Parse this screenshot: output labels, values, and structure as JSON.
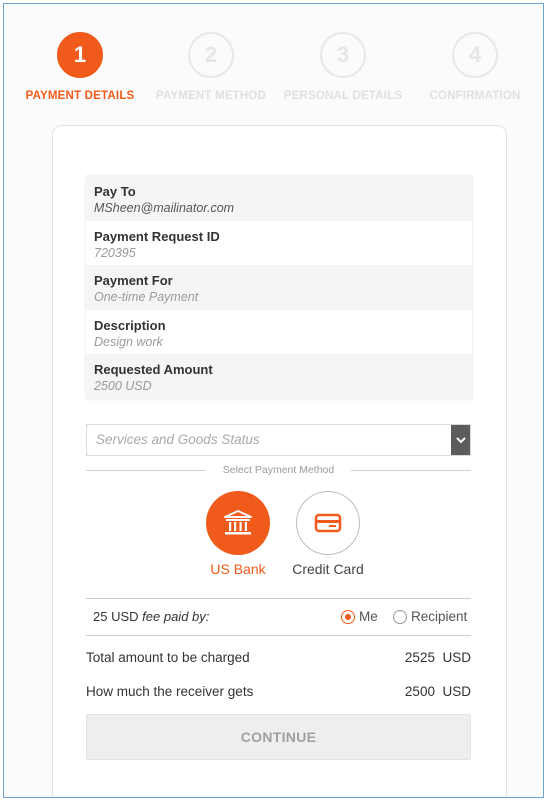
{
  "steps": [
    {
      "number": "1",
      "label": "PAYMENT DETAILS"
    },
    {
      "number": "2",
      "label": "PAYMENT METHOD"
    },
    {
      "number": "3",
      "label": "PERSONAL DETAILS"
    },
    {
      "number": "4",
      "label": "CONFIRMATION"
    }
  ],
  "summary": [
    {
      "label": "Pay To",
      "value": "MSheen@mailinator.com"
    },
    {
      "label": "Payment Request ID",
      "value": "720395"
    },
    {
      "label": "Payment For",
      "value": "One-time Payment"
    },
    {
      "label": "Description",
      "value": "Design work"
    },
    {
      "label": "Requested Amount",
      "value": "2500 USD"
    }
  ],
  "status_select": {
    "placeholder": "Services and Goods Status"
  },
  "method_divider": "Select Payment Method",
  "methods": [
    {
      "label": "US Bank",
      "icon": "bank-icon",
      "selected": true
    },
    {
      "label": "Credit Card",
      "icon": "credit-card-icon",
      "selected": false
    }
  ],
  "fee": {
    "amount": "25 USD",
    "text": "fee paid by:",
    "options": [
      {
        "label": "Me",
        "checked": true
      },
      {
        "label": "Recipient",
        "checked": false
      }
    ]
  },
  "totals": [
    {
      "label": "Total amount to be charged",
      "amount": "2525",
      "currency": "USD"
    },
    {
      "label": "How much the receiver gets",
      "amount": "2500",
      "currency": "USD"
    }
  ],
  "continue_label": "CONTINUE",
  "colors": {
    "accent": "#f05a1a",
    "border": "#6ea2cf"
  }
}
